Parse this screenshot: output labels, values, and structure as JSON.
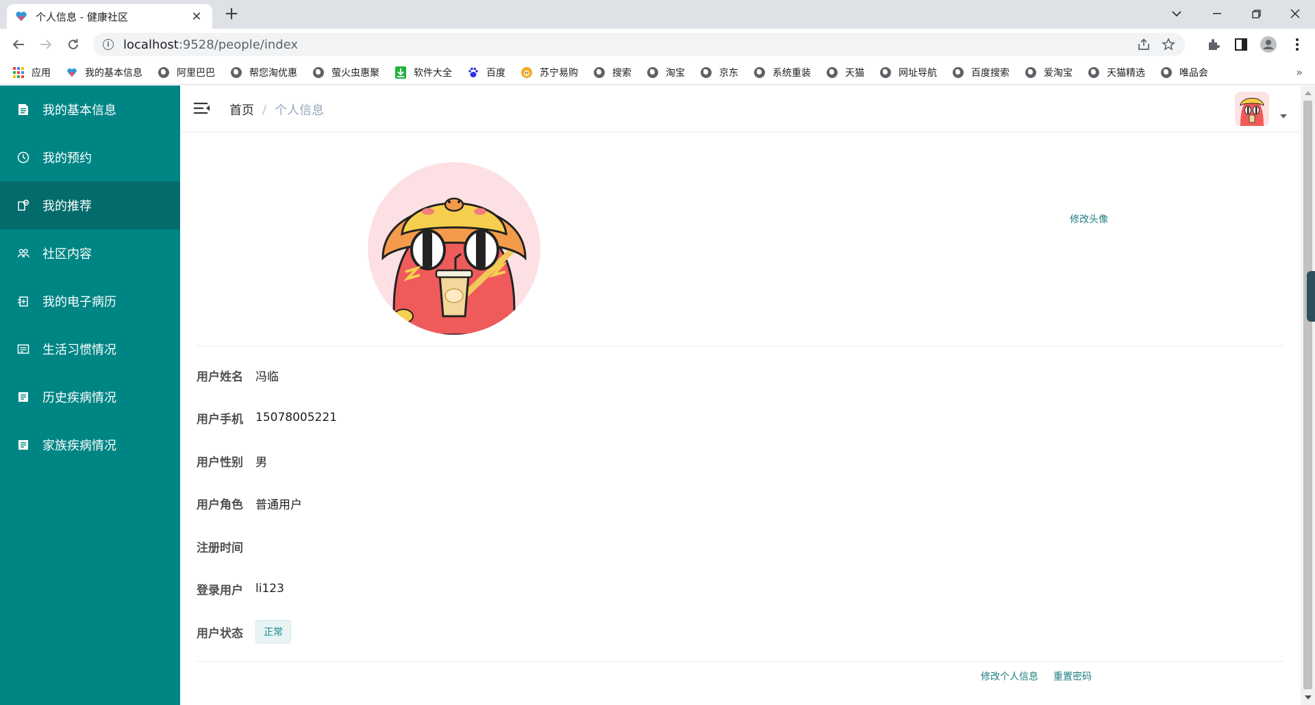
{
  "browser": {
    "tab_title": "个人信息 - 健康社区",
    "url_host": "localhost",
    "url_path": ":9528/people/index",
    "bookmarks": [
      "应用",
      "我的基本信息",
      "阿里巴巴",
      "帮您淘优惠",
      "萤火虫惠聚",
      "软件大全",
      "百度",
      "苏宁易购",
      "搜索",
      "淘宝",
      "京东",
      "系统重装",
      "天猫",
      "网址导航",
      "百度搜索",
      "爱淘宝",
      "天猫精选",
      "唯品会"
    ],
    "more_bookmarks": "»"
  },
  "sidebar": {
    "items": [
      {
        "label": "我的基本信息",
        "icon": "document-icon"
      },
      {
        "label": "我的预约",
        "icon": "clock-icon"
      },
      {
        "label": "我的推荐",
        "icon": "recommend-icon",
        "active": true
      },
      {
        "label": "社区内容",
        "icon": "community-icon"
      },
      {
        "label": "我的电子病历",
        "icon": "record-icon"
      },
      {
        "label": "生活习惯情况",
        "icon": "habit-icon"
      },
      {
        "label": "历史疾病情况",
        "icon": "history-icon"
      },
      {
        "label": "家族疾病情况",
        "icon": "family-icon"
      }
    ]
  },
  "navbar": {
    "breadcrumb_home": "首页",
    "breadcrumb_sep": "/",
    "breadcrumb_current": "个人信息"
  },
  "profile": {
    "change_avatar": "修改头像",
    "fields": [
      {
        "label": "用户姓名",
        "value": "冯临"
      },
      {
        "label": "用户手机",
        "value": "15078005221"
      },
      {
        "label": "用户性别",
        "value": "男"
      },
      {
        "label": "用户角色",
        "value": "普通用户"
      },
      {
        "label": "注册时间",
        "value": ""
      },
      {
        "label": "登录用户",
        "value": "li123"
      },
      {
        "label": "用户状态",
        "value": "正常"
      }
    ],
    "edit_info": "修改个人信息",
    "reset_password": "重置密码"
  },
  "colors": {
    "sidebar_bg": "#008585",
    "sidebar_active": "#036b6b",
    "link": "#1e7c80"
  }
}
